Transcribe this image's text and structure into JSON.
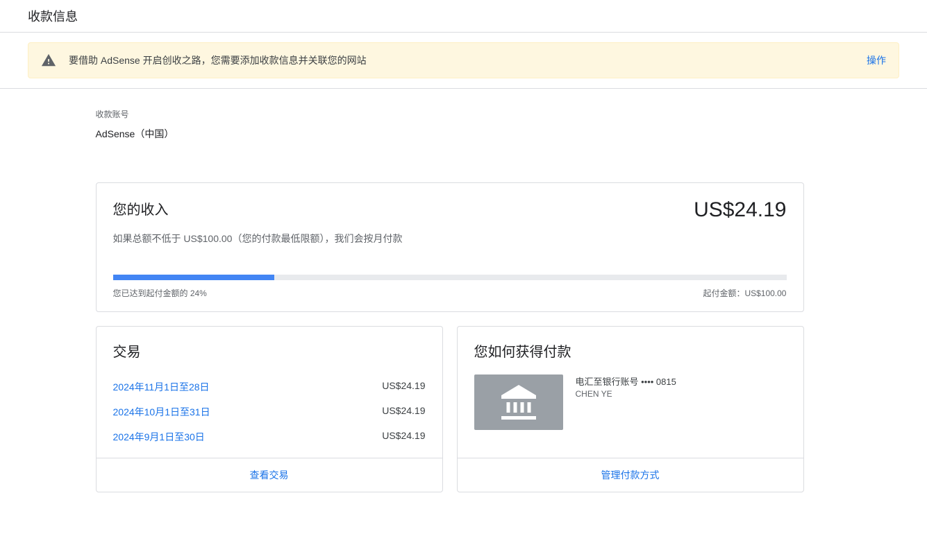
{
  "page": {
    "title": "收款信息"
  },
  "alert": {
    "message": "要借助 AdSense 开启创收之路，您需要添加收款信息并关联您的网站",
    "action": "操作"
  },
  "account": {
    "label": "收款账号",
    "value": "AdSense（中国）"
  },
  "earnings": {
    "title": "您的收入",
    "amount": "US$24.19",
    "subtitle": "如果总额不低于 US$100.00（您的付款最低限额），我们会按月付款",
    "progress_percent": 24,
    "progress_label": "您已达到起付金额的 24%",
    "threshold_label": "起付金额：US$100.00"
  },
  "transactions": {
    "title": "交易",
    "items": [
      {
        "date": "2024年11月1日至28日",
        "amount": "US$24.19"
      },
      {
        "date": "2024年10月1日至31日",
        "amount": "US$24.19"
      },
      {
        "date": "2024年9月1日至30日",
        "amount": "US$24.19"
      }
    ],
    "view_all": "查看交易"
  },
  "payment_method": {
    "title": "您如何获得付款",
    "description": "电汇至银行账号 •••• 0815",
    "holder": "CHEN YE",
    "manage": "管理付款方式"
  }
}
